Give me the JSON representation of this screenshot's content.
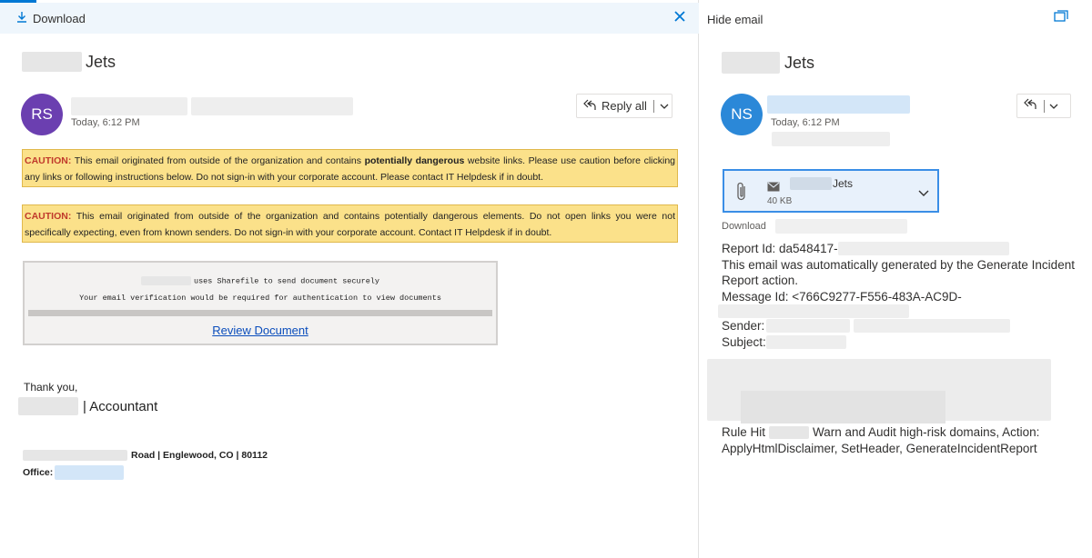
{
  "left_pane": {
    "toolbar": {
      "download_label": "Download"
    },
    "subject_suffix": "Jets",
    "message": {
      "avatar_initials": "RS",
      "timestamp": "Today, 6:12 PM",
      "reply_all_label": "Reply all"
    },
    "caution_1": {
      "label": "CAUTION:",
      "text_a": " This email originated from outside of the organization and contains ",
      "bold": "potentially dangerous",
      "text_b": " website links. Please use caution before clicking any links or following instructions below. Do not sign-in with your corporate account. Please contact IT Helpdesk if in doubt."
    },
    "caution_2": {
      "label": "CAUTION:",
      "text": " This email originated from outside of the organization and contains potentially dangerous elements. Do not open links you were not specifically expecting, even from known senders. Do not sign-in with your corporate account. Contact IT Helpdesk if in doubt."
    },
    "sharefile": {
      "line1_suffix": "uses Sharefile to send document securely",
      "line2": "Your email verification would be required for authentication to view documents",
      "link_label": "Review Document"
    },
    "signature": {
      "greeting": "Thank you,",
      "title": "| Accountant",
      "address_suffix": "Road | Englewood, CO | 80112",
      "office_label": "Office:"
    }
  },
  "right_pane": {
    "hide_email_label": "Hide email",
    "subject_suffix": "Jets",
    "message": {
      "avatar_initials": "NS",
      "timestamp": "Today, 6:12 PM"
    },
    "attachment": {
      "name_suffix": "Jets",
      "size": "40 KB",
      "download_label": "Download"
    },
    "report": {
      "report_id_label": "Report Id: da548417-",
      "auto_line_1": "This email was automatically generated by the Generate Incident",
      "auto_line_2": "Report action.",
      "message_id": "Message Id: <766C9277-F556-483A-AC9D-",
      "sender_label": "Sender:",
      "subject_label": "Subject:"
    },
    "rule_hit": {
      "prefix": "Rule Hit",
      "suffix": "Warn and Audit high-risk domains, Action:",
      "line2": "ApplyHtmlDisclaimer, SetHeader, GenerateIncidentReport"
    }
  },
  "colors": {
    "accent": "#0078d4",
    "caution_bg": "#fbe18a",
    "caution_label": "#c0392b",
    "avatar_rs": "#6b3fb0",
    "avatar_ns": "#2b88d8",
    "link": "#0a4dbc",
    "attachment_border": "#3a8ee6"
  },
  "icons": [
    "download-icon",
    "close-icon",
    "reply-all-icon",
    "chevron-down-icon",
    "popout-icon",
    "paperclip-icon",
    "mail-icon"
  ]
}
